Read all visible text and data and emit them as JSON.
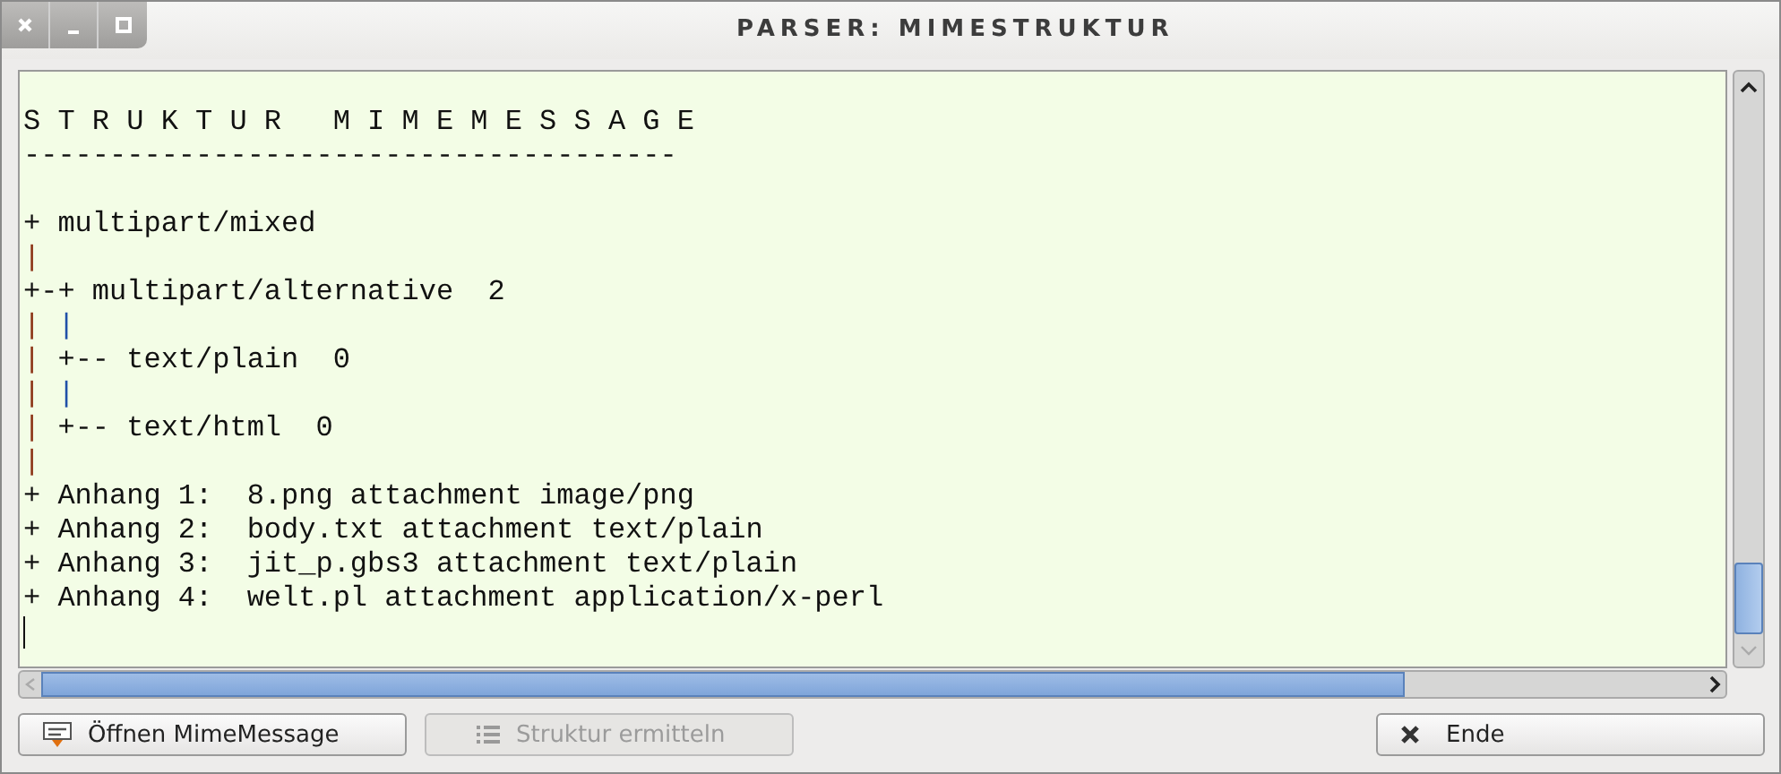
{
  "window": {
    "title": "PARSER: MIMESTRUKTUR"
  },
  "output": {
    "lines": [
      {
        "kind": "blank"
      },
      {
        "kind": "text",
        "segments": [
          {
            "text": "S T R U K T U R   M I M E M E S S A G E"
          }
        ]
      },
      {
        "kind": "text",
        "segments": [
          {
            "text": "--------------------------------------"
          }
        ]
      },
      {
        "kind": "blank"
      },
      {
        "kind": "text",
        "segments": [
          {
            "text": "+ multipart/mixed"
          }
        ]
      },
      {
        "kind": "text",
        "segments": [
          {
            "text": "|",
            "color": "#8b3214"
          }
        ]
      },
      {
        "kind": "text",
        "segments": [
          {
            "text": "+-+ multipart/alternative  2"
          }
        ]
      },
      {
        "kind": "text",
        "segments": [
          {
            "text": "|",
            "color": "#8b3214"
          },
          {
            "text": " |",
            "color": "#2050a8"
          }
        ]
      },
      {
        "kind": "text",
        "segments": [
          {
            "text": "|",
            "color": "#8b3214"
          },
          {
            "text": " +-- text/plain  0"
          }
        ]
      },
      {
        "kind": "text",
        "segments": [
          {
            "text": "|",
            "color": "#8b3214"
          },
          {
            "text": " |",
            "color": "#2050a8"
          }
        ]
      },
      {
        "kind": "text",
        "segments": [
          {
            "text": "|",
            "color": "#8b3214"
          },
          {
            "text": " +-- text/html  0"
          }
        ]
      },
      {
        "kind": "text",
        "segments": [
          {
            "text": "|",
            "color": "#8b3214"
          }
        ]
      },
      {
        "kind": "text",
        "segments": [
          {
            "text": "+ Anhang 1:  8.png attachment image/png"
          }
        ]
      },
      {
        "kind": "text",
        "segments": [
          {
            "text": "+ Anhang 2:  body.txt attachment text/plain"
          }
        ]
      },
      {
        "kind": "text",
        "segments": [
          {
            "text": "+ Anhang 3:  jit_p.gbs3 attachment text/plain"
          }
        ]
      },
      {
        "kind": "text",
        "segments": [
          {
            "text": "+ Anhang 4:  welt.pl attachment application/x-perl"
          }
        ]
      },
      {
        "kind": "caret"
      }
    ]
  },
  "buttons": [
    {
      "kind": "open",
      "label": "Öffnen MimeMessage",
      "disabled": false
    },
    {
      "kind": "list",
      "label": "Struktur ermitteln",
      "disabled": true
    },
    {
      "kind": "close",
      "label": "Ende",
      "disabled": false
    }
  ]
}
